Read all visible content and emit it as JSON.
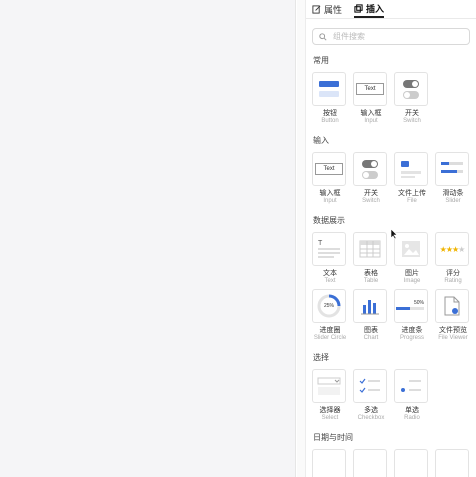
{
  "tabs": [
    {
      "label": "属性",
      "icon": "edit-icon"
    },
    {
      "label": "插入",
      "icon": "insert-icon",
      "active": true
    }
  ],
  "search": {
    "placeholder": "组件搜索"
  },
  "sections": [
    {
      "title": "常用",
      "items": [
        {
          "label": "按钮",
          "sub": "Button",
          "icon": "button-icon"
        },
        {
          "label": "输入框",
          "sub": "Input",
          "icon": "input-icon",
          "thumb_text": "Text"
        },
        {
          "label": "开关",
          "sub": "Switch",
          "icon": "switch-icon"
        }
      ]
    },
    {
      "title": "输入",
      "items": [
        {
          "label": "输入框",
          "sub": "Input",
          "icon": "input-icon",
          "thumb_text": "Text"
        },
        {
          "label": "开关",
          "sub": "Switch",
          "icon": "switch-icon"
        },
        {
          "label": "文件上传",
          "sub": "File",
          "icon": "file-upload-icon"
        },
        {
          "label": "滑动条",
          "sub": "Slider",
          "icon": "slider-icon"
        }
      ]
    },
    {
      "title": "数据展示",
      "items": [
        {
          "label": "文本",
          "sub": "Text",
          "icon": "text-icon"
        },
        {
          "label": "表格",
          "sub": "Table",
          "icon": "table-icon"
        },
        {
          "label": "图片",
          "sub": "Image",
          "icon": "image-icon"
        },
        {
          "label": "评分",
          "sub": "Rating",
          "icon": "rating-icon"
        },
        {
          "label": "进度圈",
          "sub": "Slider Circle",
          "icon": "progress-circle-icon",
          "thumb_text": "25%"
        },
        {
          "label": "图表",
          "sub": "Chart",
          "icon": "chart-icon"
        },
        {
          "label": "进度条",
          "sub": "Progress",
          "icon": "progress-bar-icon",
          "thumb_text": "50%"
        },
        {
          "label": "文件预览",
          "sub": "File Viewer",
          "icon": "file-viewer-icon"
        }
      ]
    },
    {
      "title": "选择",
      "items": [
        {
          "label": "选择器",
          "sub": "Select",
          "icon": "select-icon"
        },
        {
          "label": "多选",
          "sub": "Checkbox",
          "icon": "checkbox-icon"
        },
        {
          "label": "单选",
          "sub": "Radio",
          "icon": "radio-icon"
        }
      ]
    },
    {
      "title": "日期与时间",
      "items": []
    }
  ],
  "colors": {
    "accent": "#3b6fd6",
    "border": "#e3e3e3"
  }
}
